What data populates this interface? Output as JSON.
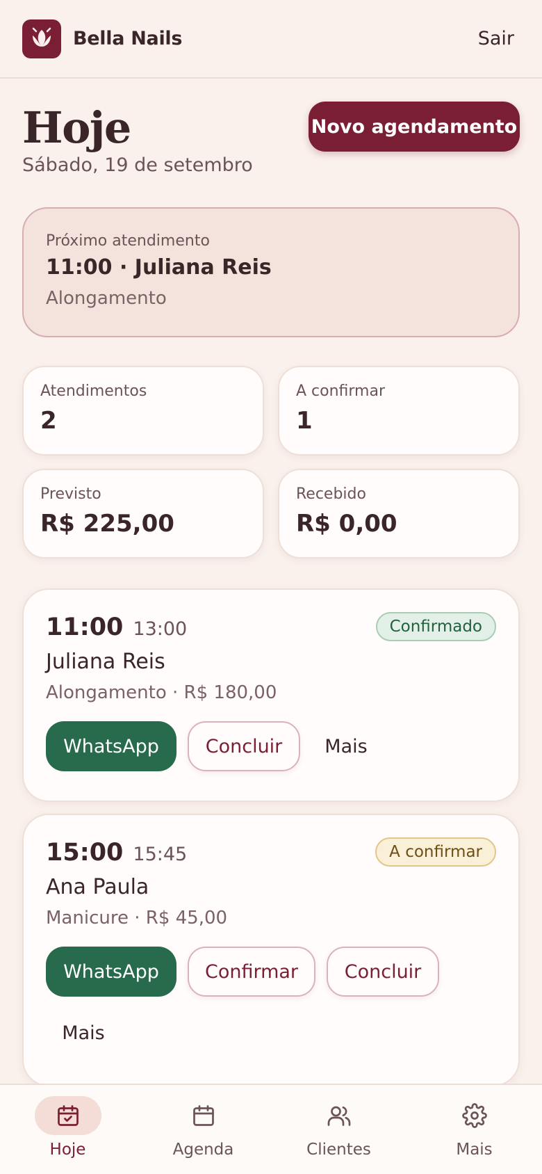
{
  "header": {
    "brand": "Bella Nails",
    "signout": "Sair"
  },
  "page": {
    "title": "Hoje",
    "date": "Sábado, 19 de setembro",
    "new_button": "Novo agendamento"
  },
  "next": {
    "label": "Próximo atendimento",
    "main": "11:00 · Juliana Reis",
    "service": "Alongamento"
  },
  "stats": [
    {
      "label": "Atendimentos",
      "value": "2"
    },
    {
      "label": "A confirmar",
      "value": "1"
    },
    {
      "label": "Previsto",
      "value": "R$ 225,00"
    },
    {
      "label": "Recebido",
      "value": "R$ 0,00"
    }
  ],
  "appointments": [
    {
      "start": "11:00",
      "end": "13:00",
      "status": "Confirmado",
      "client": "Juliana Reis",
      "detail": "Alongamento · R$ 180,00",
      "actions": {
        "whatsapp": "WhatsApp",
        "complete": "Concluir",
        "more": "Mais"
      }
    },
    {
      "start": "15:00",
      "end": "15:45",
      "status": "A confirmar",
      "client": "Ana Paula",
      "detail": "Manicure · R$ 45,00",
      "actions": {
        "whatsapp": "WhatsApp",
        "confirm": "Confirmar",
        "complete": "Concluir",
        "more": "Mais"
      }
    }
  ],
  "nav": [
    {
      "label": "Hoje",
      "icon": "calendar-check-icon",
      "active": true
    },
    {
      "label": "Agenda",
      "icon": "calendar-icon"
    },
    {
      "label": "Clientes",
      "icon": "users-icon"
    },
    {
      "label": "Mais",
      "icon": "gear-icon"
    }
  ],
  "colors": {
    "brand": "#7a1f33",
    "whatsapp": "#276b4c",
    "background": "#faf1ec"
  }
}
